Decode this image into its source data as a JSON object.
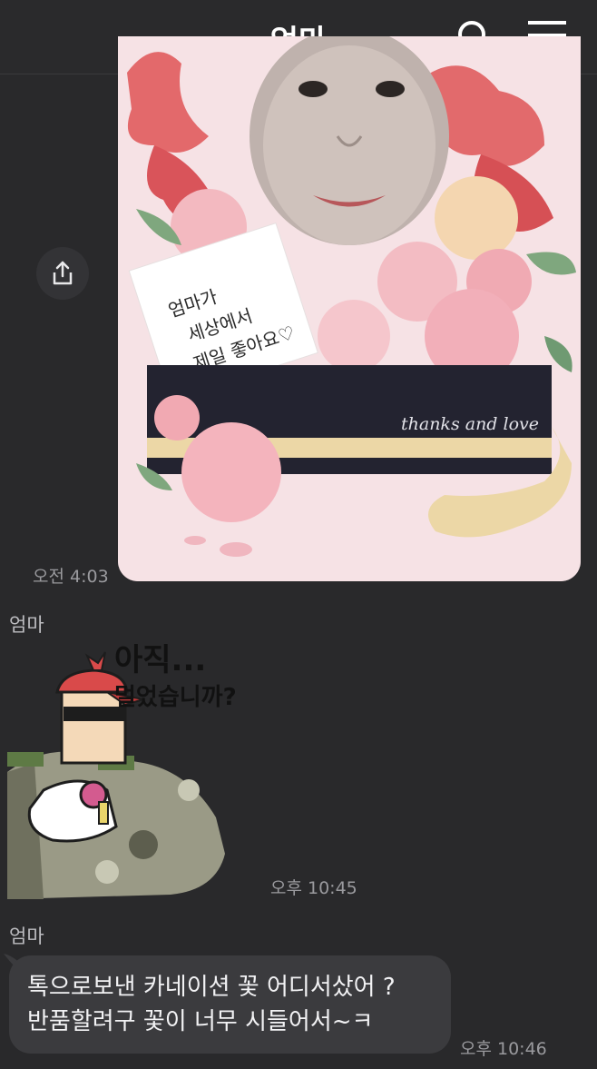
{
  "header": {
    "title": "엄마",
    "search_icon": "search-icon",
    "menu_icon": "hamburger-menu-icon"
  },
  "messages": [
    {
      "kind": "image",
      "from": "me",
      "image": "photo-card-thanks-and-love",
      "card_text_lines": [
        "엄마가",
        "세상에서",
        "제일 좋아요♡"
      ],
      "ribbon_text": "thanks and love",
      "time": "오전 4:03",
      "share_icon": "share-icon"
    },
    {
      "kind": "sticker",
      "from": "other",
      "sender": "엄마",
      "sticker_text_lines": [
        "아직...",
        "멀었습니까?"
      ],
      "time": "오후 10:45"
    },
    {
      "kind": "text",
      "from": "other",
      "sender": "엄마",
      "lines": [
        "톡으로보낸  카네이션 꽃 어디서샀어 ?",
        "반품할려구 꽃이 너무 시들어서~ㅋ"
      ],
      "time": "오후 10:46"
    }
  ],
  "colors": {
    "background": "#29292b",
    "bubble": "#3b3b3e",
    "time_text": "#9a9a9e"
  }
}
